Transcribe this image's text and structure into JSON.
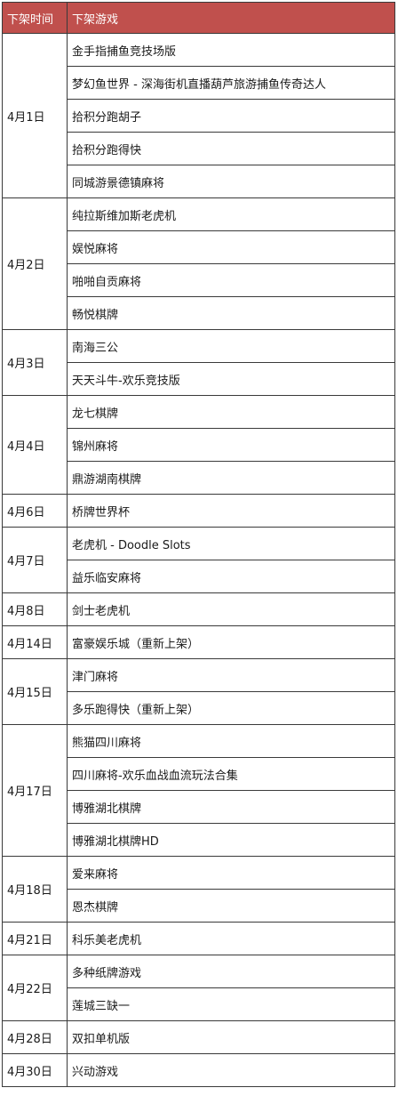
{
  "header": {
    "time": "下架时间",
    "game": "下架游戏"
  },
  "groups": [
    {
      "date": "4月1日",
      "games": [
        "金手指捕鱼竞技场版",
        "梦幻鱼世界 - 深海街机直播葫芦旅游捕鱼传奇达人",
        "拾积分跑胡子",
        "拾积分跑得快",
        "同城游景德镇麻将"
      ]
    },
    {
      "date": "4月2日",
      "games": [
        "纯拉斯维加斯老虎机",
        "娱悦麻将",
        "啪啪自贡麻将",
        "畅悦棋牌"
      ]
    },
    {
      "date": "4月3日",
      "games": [
        "南海三公",
        "天天斗牛-欢乐竞技版"
      ]
    },
    {
      "date": "4月4日",
      "games": [
        "龙七棋牌",
        "锦州麻将",
        "鼎游湖南棋牌"
      ]
    },
    {
      "date": "4月6日",
      "games": [
        "桥牌世界杯"
      ]
    },
    {
      "date": "4月7日",
      "games": [
        "老虎机 - Doodle Slots",
        "益乐临安麻将"
      ]
    },
    {
      "date": "4月8日",
      "games": [
        "剑士老虎机"
      ]
    },
    {
      "date": "4月14日",
      "games": [
        "富豪娱乐城（重新上架）"
      ]
    },
    {
      "date": "4月15日",
      "games": [
        "津门麻将",
        "多乐跑得快（重新上架）"
      ]
    },
    {
      "date": "4月17日",
      "games": [
        "熊猫四川麻将",
        "四川麻将-欢乐血战血流玩法合集",
        "博雅湖北棋牌",
        "博雅湖北棋牌HD"
      ]
    },
    {
      "date": "4月18日",
      "games": [
        "爱来麻将",
        "恩杰棋牌"
      ]
    },
    {
      "date": "4月21日",
      "games": [
        "科乐美老虎机"
      ]
    },
    {
      "date": "4月22日",
      "games": [
        "多种纸牌游戏",
        "莲城三缺一"
      ]
    },
    {
      "date": "4月28日",
      "games": [
        "双扣单机版"
      ]
    },
    {
      "date": "4月30日",
      "games": [
        "兴动游戏"
      ]
    }
  ]
}
